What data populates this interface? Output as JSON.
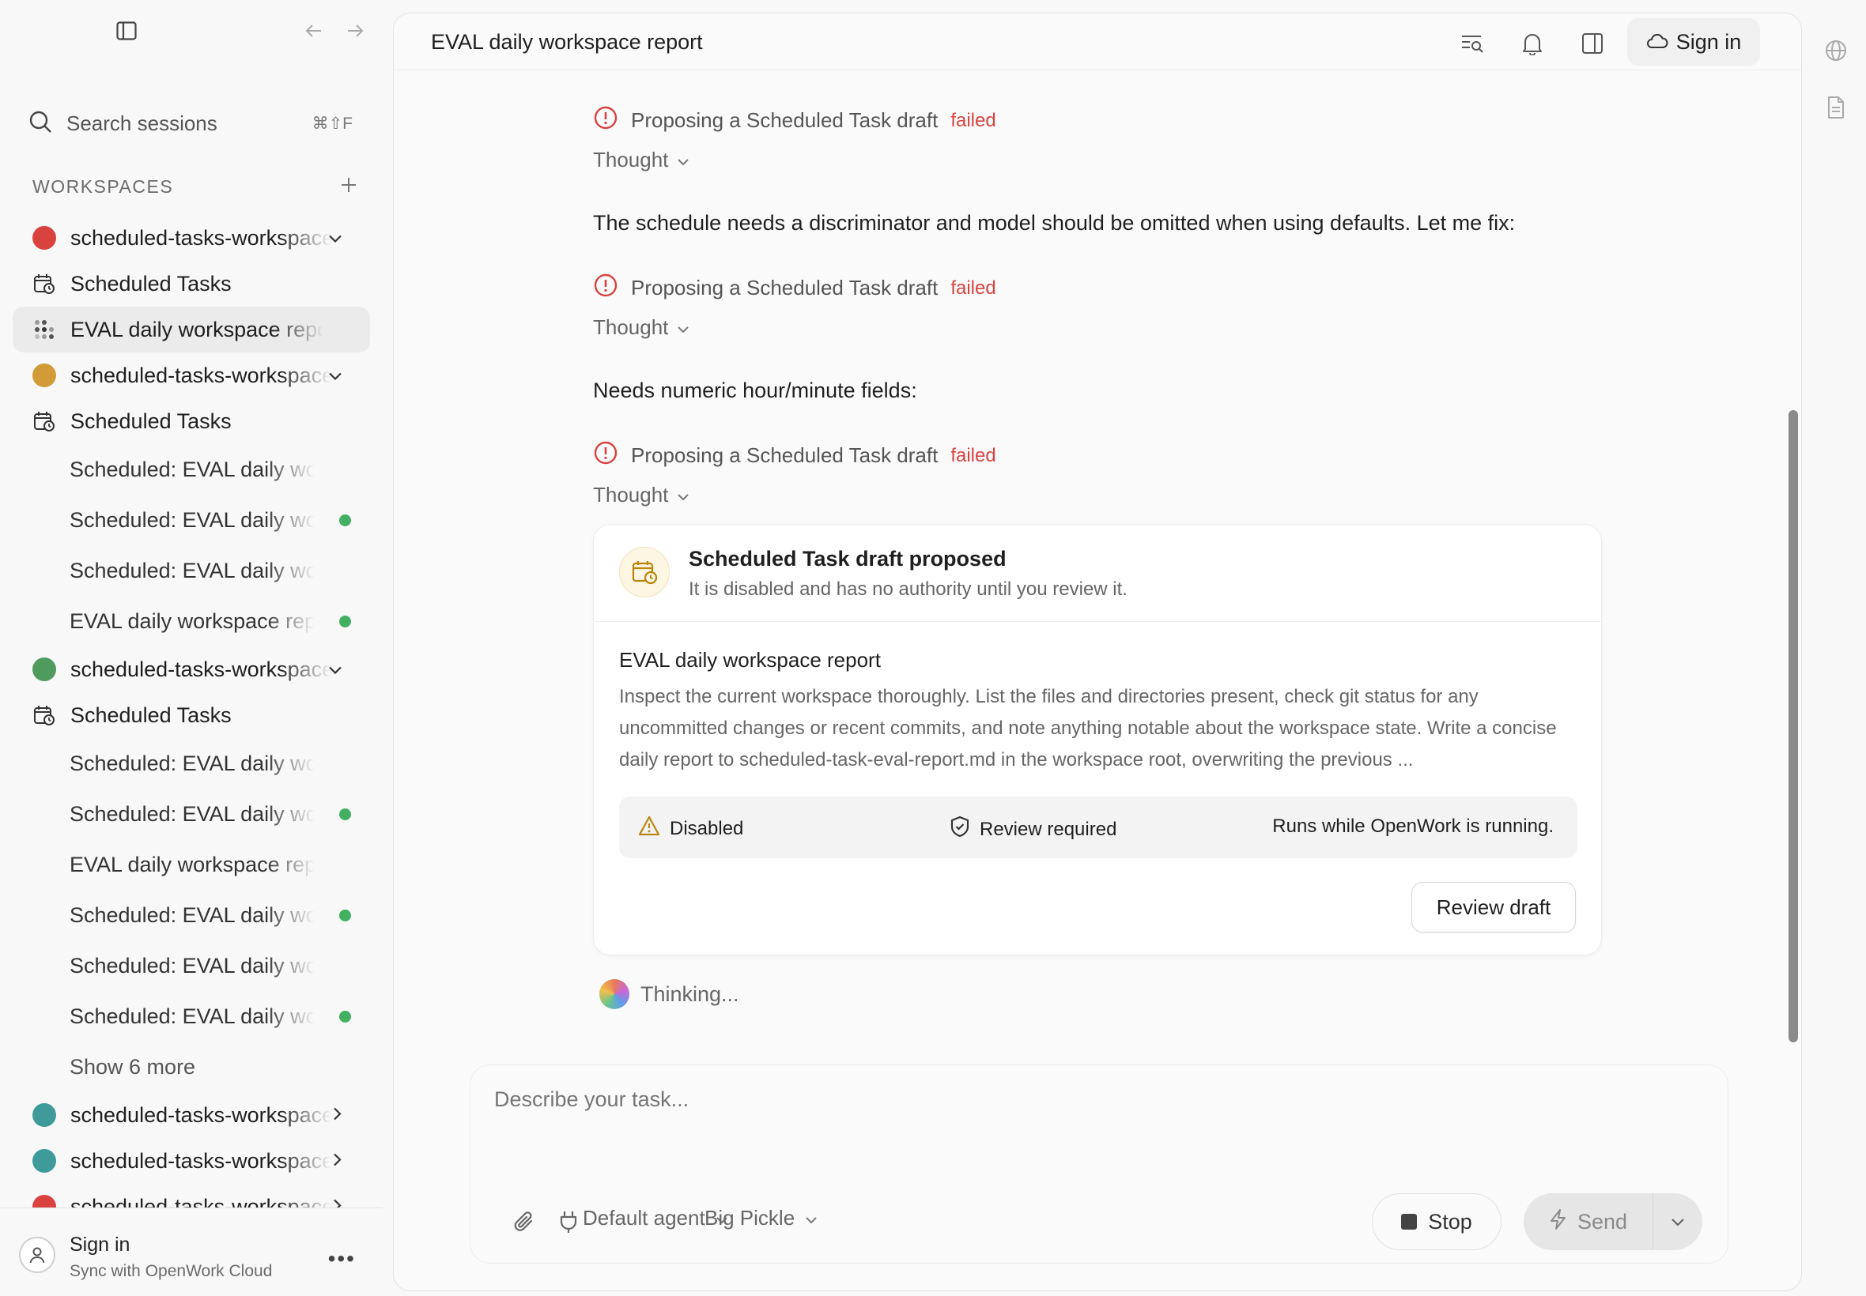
{
  "sidebar": {
    "search": {
      "label": "Search sessions",
      "shortcut": "⌘⇧F"
    },
    "workspaces_title": "WORKSPACES",
    "items": [
      {
        "kind": "workspace",
        "label": "scheduled-tasks-workspace",
        "color": "#d9423f",
        "chevron": "down"
      },
      {
        "kind": "task-group",
        "label": "Scheduled Tasks"
      },
      {
        "kind": "session",
        "label": "EVAL daily workspace report",
        "active": true,
        "loading": true
      },
      {
        "kind": "workspace",
        "label": "scheduled-tasks-workspace",
        "color": "#d39a38",
        "chevron": "down"
      },
      {
        "kind": "task-group",
        "label": "Scheduled Tasks"
      },
      {
        "kind": "sub",
        "label": "Scheduled: EVAL daily workspace report",
        "dot": false
      },
      {
        "kind": "sub",
        "label": "Scheduled: EVAL daily workspace report",
        "dot": true
      },
      {
        "kind": "sub",
        "label": "Scheduled: EVAL daily workspace report",
        "dot": false
      },
      {
        "kind": "sub",
        "label": "EVAL daily workspace report",
        "dot": true
      },
      {
        "kind": "workspace",
        "label": "scheduled-tasks-workspace",
        "color": "#4f9a5e",
        "chevron": "down"
      },
      {
        "kind": "task-group",
        "label": "Scheduled Tasks"
      },
      {
        "kind": "sub",
        "label": "Scheduled: EVAL daily workspace report",
        "dot": false
      },
      {
        "kind": "sub",
        "label": "Scheduled: EVAL daily workspace report",
        "dot": true
      },
      {
        "kind": "sub",
        "label": "EVAL daily workspace report",
        "dot": false
      },
      {
        "kind": "sub",
        "label": "Scheduled: EVAL daily workspace report",
        "dot": true
      },
      {
        "kind": "sub",
        "label": "Scheduled: EVAL daily workspace report",
        "dot": false
      },
      {
        "kind": "sub",
        "label": "Scheduled: EVAL daily workspace report",
        "dot": true
      },
      {
        "kind": "more",
        "label": "Show 6 more"
      },
      {
        "kind": "workspace",
        "label": "scheduled-tasks-workspace",
        "color": "#3f9a9a",
        "chevron": "right"
      },
      {
        "kind": "workspace",
        "label": "scheduled-tasks-workspace",
        "color": "#3f9a9a",
        "chevron": "right"
      },
      {
        "kind": "workspace",
        "label": "scheduled-tasks-workspace",
        "color": "#d9423f",
        "chevron": "right"
      }
    ],
    "user": {
      "name": "Sign in",
      "sub": "Sync with OpenWork Cloud"
    }
  },
  "header": {
    "title": "EVAL daily workspace report",
    "sign_in": "Sign in"
  },
  "messages": {
    "tool_label": "Proposing a Scheduled Task draft",
    "failed": "failed",
    "thought": "Thought",
    "para1": "The schedule needs a discriminator and model should be omitted when using defaults. Let me fix:",
    "para2": "Needs numeric hour/minute fields:"
  },
  "card": {
    "title": "Scheduled Task draft proposed",
    "subtitle": "It is disabled and has no authority until you review it.",
    "task_name": "EVAL daily workspace report",
    "task_desc": "Inspect the current workspace thoroughly. List the files and directories present, check git status for any uncommitted changes or recent commits, and note anything notable about the workspace state. Write a concise daily report to scheduled-task-eval-report.md in the workspace root, overwriting the previous ...",
    "status_disabled": "Disabled",
    "status_review": "Review required",
    "status_runs": "Runs while OpenWork is running.",
    "review_button": "Review draft"
  },
  "thinking": "Thinking...",
  "composer": {
    "placeholder": "Describe your task...",
    "agent": "Default agent",
    "model": "Big Pickle",
    "stop": "Stop",
    "send": "Send"
  },
  "colors": {
    "failed": "#d9423f",
    "online_dot": "#43b061",
    "warning": "#b8860b"
  }
}
